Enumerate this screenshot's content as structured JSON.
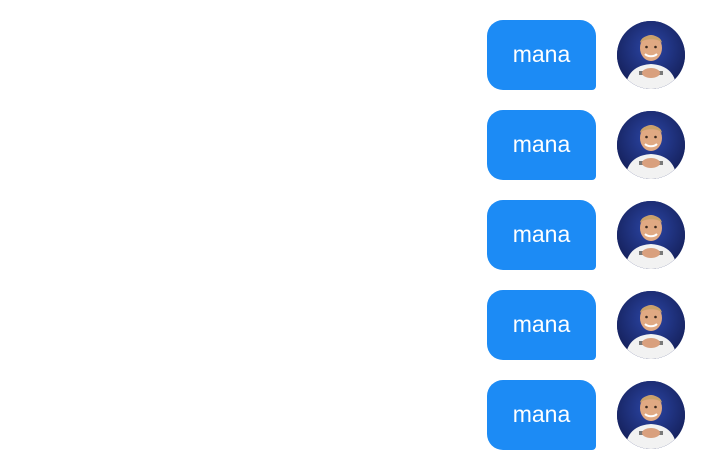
{
  "messages": [
    {
      "text": "mana",
      "avatar": "player-avatar-icon"
    },
    {
      "text": "mana",
      "avatar": "player-avatar-icon"
    },
    {
      "text": "mana",
      "avatar": "player-avatar-icon"
    },
    {
      "text": "mana",
      "avatar": "player-avatar-icon"
    },
    {
      "text": "mana",
      "avatar": "player-avatar-icon"
    }
  ],
  "colors": {
    "bubble": "#1c8bf5",
    "bubble_text": "#ffffff",
    "avatar_bg": "#1b2c7a",
    "background": "#ffffff"
  }
}
